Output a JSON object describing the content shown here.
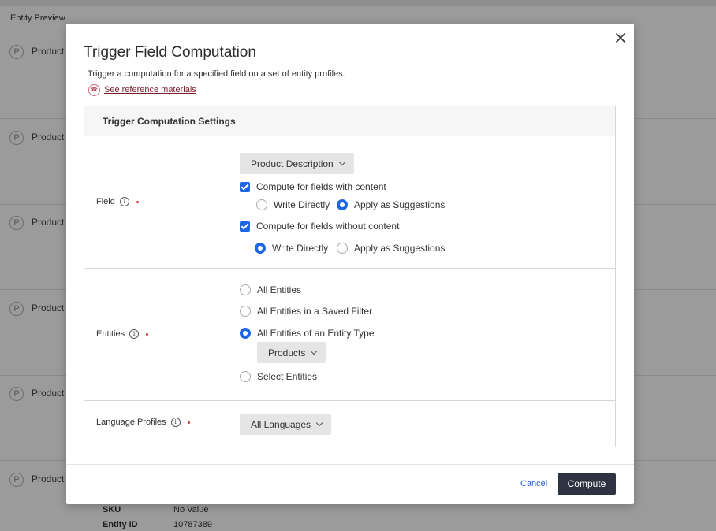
{
  "background": {
    "header_label": "Entity Preview",
    "rows": [
      {
        "icon_letter": "P",
        "name": "Product"
      },
      {
        "icon_letter": "P",
        "name": "Product"
      },
      {
        "icon_letter": "P",
        "name": "Product"
      },
      {
        "icon_letter": "P",
        "name": "Product"
      },
      {
        "icon_letter": "P",
        "name": "Product"
      },
      {
        "icon_letter": "P",
        "name": "Product"
      }
    ],
    "details": {
      "sku_label": "SKU",
      "sku_value": "No Value",
      "entity_id_label": "Entity ID",
      "entity_id_value": "10787389"
    }
  },
  "modal": {
    "title": "Trigger Field Computation",
    "description": "Trigger a computation for a specified field on a set of entity profiles.",
    "reference_link": "See reference materials",
    "settings_header": "Trigger Computation Settings",
    "field": {
      "label": "Field",
      "selected": "Product Description",
      "with_content_label": "Compute for fields with content",
      "with_content_checked": true,
      "with_content_options": [
        {
          "label": "Write Directly",
          "selected": false
        },
        {
          "label": "Apply as Suggestions",
          "selected": true
        }
      ],
      "without_content_label": "Compute for fields without content",
      "without_content_checked": true,
      "without_content_options": [
        {
          "label": "Write Directly",
          "selected": true
        },
        {
          "label": "Apply as Suggestions",
          "selected": false
        }
      ]
    },
    "entities": {
      "label": "Entities",
      "options": [
        {
          "label": "All Entities",
          "selected": false
        },
        {
          "label": "All Entities in a Saved Filter",
          "selected": false
        },
        {
          "label": "All Entities of an Entity Type",
          "selected": true
        },
        {
          "label": "Select Entities",
          "selected": false
        }
      ],
      "entity_type": "Products"
    },
    "language_profiles": {
      "label": "Language Profiles",
      "selected": "All Languages"
    },
    "cancel_label": "Cancel",
    "compute_label": "Compute"
  },
  "colors": {
    "accent": "#1f66e5",
    "primary_button": "#2d3340",
    "required": "#c0392b",
    "link": "#7a1f2b"
  }
}
